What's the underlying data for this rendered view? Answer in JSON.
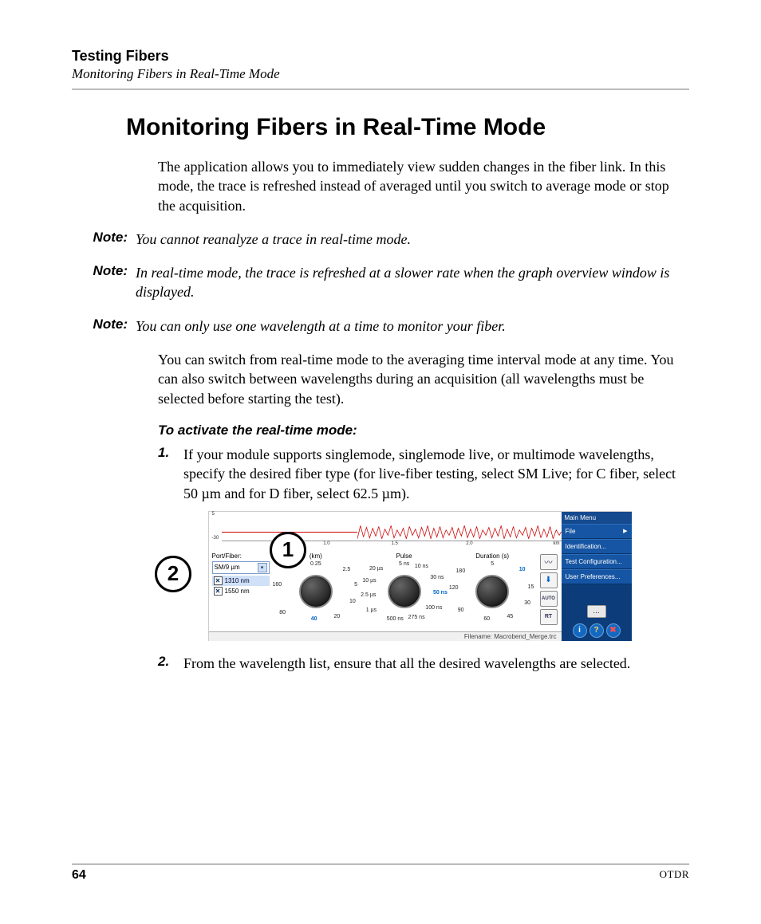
{
  "header": {
    "chapter": "Testing Fibers",
    "section": "Monitoring Fibers in Real-Time Mode"
  },
  "title": "Monitoring Fibers in Real-Time Mode",
  "paragraphs": {
    "p1": "The application allows you to immediately view sudden changes in the fiber link. In this mode, the trace is refreshed instead of averaged until you switch to average mode or stop the acquisition.",
    "p2": "You can switch from real-time mode to the averaging time interval mode at any time. You can also switch between wavelengths during an acquisition (all wavelengths must be selected before starting the test)."
  },
  "notes": {
    "label": "Note:",
    "n1": "You cannot reanalyze a trace in real-time mode.",
    "n2": "In real-time mode, the trace is refreshed at a slower rate when the graph overview window is displayed.",
    "n3": "You can only use one wavelength at a time to monitor your fiber."
  },
  "heading_activate": "To activate the real-time mode:",
  "steps": {
    "s1_num": "1.",
    "s1_text": "If your module supports singlemode, singlemode live, or multimode wavelengths, specify the desired fiber type (for live-fiber testing, select SM Live; for C fiber, select 50 µm and for D fiber, select 62.5 µm).",
    "s2_num": "2.",
    "s2_text": "From the wavelength list, ensure that all the desired wavelengths are selected."
  },
  "callouts": {
    "c1": "1",
    "c2": "2"
  },
  "figure": {
    "trace": {
      "y_top": "5",
      "y_bottom": "-30",
      "x_ticks": [
        "1.0",
        "1.5",
        "2.0"
      ],
      "x_unit": "km"
    },
    "port": {
      "label": "Port/Fiber:",
      "selected": "SM/9 µm",
      "wavelengths": [
        "1310 nm",
        "1550 nm"
      ]
    },
    "dials": {
      "range": {
        "title": "(km)",
        "labels": [
          "0.25",
          "2.5",
          "5",
          "10",
          "20",
          "40",
          "80",
          "160"
        ],
        "highlight": "40"
      },
      "pulse": {
        "title": "Pulse",
        "labels": [
          "5 ns",
          "10 ns",
          "30 ns",
          "50 ns",
          "100 ns",
          "275 ns",
          "500 ns",
          "1 µs",
          "2.5 µs",
          "10 µs",
          "20 µs"
        ],
        "highlight": "50 ns"
      },
      "duration": {
        "title": "Duration (s)",
        "labels": [
          "5",
          "10",
          "15",
          "30",
          "45",
          "60",
          "90",
          "120",
          "180"
        ],
        "highlight": "10"
      }
    },
    "side_icons": [
      "trace-icon",
      "download-icon",
      "auto-icon",
      "rt-icon"
    ],
    "menu": {
      "title": "Main Menu",
      "items": [
        "File",
        "Identification...",
        "Test Configuration...",
        "User Preferences..."
      ],
      "more": "..."
    },
    "status": "Filename: Macrobend_Merge.trc"
  },
  "footer": {
    "page": "64",
    "right": "OTDR"
  }
}
